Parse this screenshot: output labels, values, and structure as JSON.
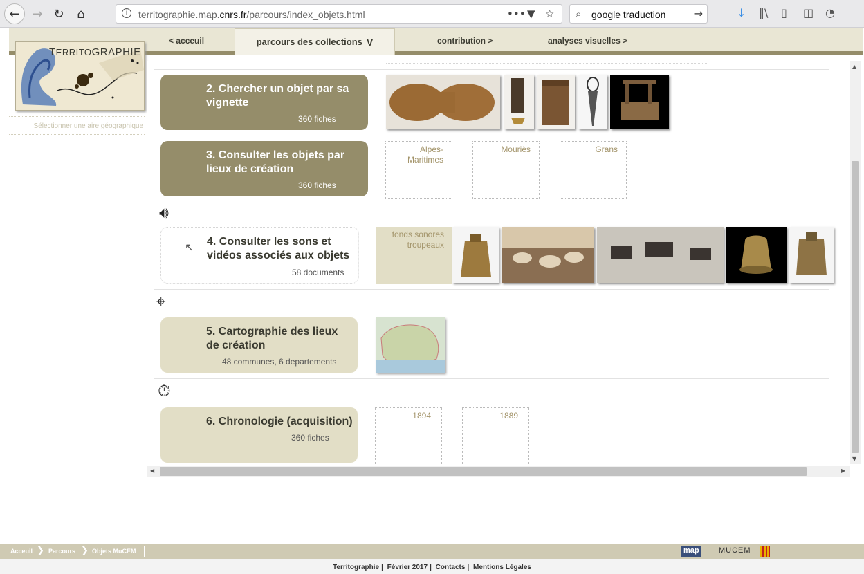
{
  "browser": {
    "url_prefix": "territographie.map.",
    "url_domain": "cnrs.fr",
    "url_path": "/parcours/index_objets.html",
    "search_query": "google traduction"
  },
  "nav": {
    "home": "< acceuil",
    "collections": "parcours des collections",
    "collections_marker": "V",
    "contribution": "contribution >",
    "analyses": "analyses visuelles >"
  },
  "logo": {
    "title_prefix": "T",
    "title_mid": "ERRITO",
    "title_rest": "GRAPHIE"
  },
  "geo_select": "Sélectionner une aire géographique",
  "sections": [
    {
      "title": "2. Chercher un objet par sa vignette",
      "count": "360 fiches"
    },
    {
      "title": "3. Consulter les objets par lieux de création",
      "count": "360 fiches"
    },
    {
      "title": "4. Consulter les sons et vidéos associés aux objets",
      "count": "58 documents"
    },
    {
      "title": "5. Cartographie des lieux de création",
      "count": "48 communes, 6 departements"
    },
    {
      "title": "6. Chronologie (acquisition)",
      "count": "360 fiches"
    }
  ],
  "places": [
    "Alpes-Maritimes",
    "Mouriès",
    "Grans"
  ],
  "sound_fonds": "fonds sonores troupeaux",
  "years": [
    "1894",
    "1889"
  ],
  "icons": {
    "sound": "speaker-icon",
    "map": "crosshair-icon",
    "chrono": "stopwatch-icon"
  },
  "breadcrumb": [
    "Acceuil",
    "Parcours",
    "Objets MuCEM"
  ],
  "partners": {
    "map": "map",
    "mucem": "MUCEM"
  },
  "footer": [
    "Territographie",
    "Février 2017",
    "Contacts",
    "Mentions Légales"
  ]
}
